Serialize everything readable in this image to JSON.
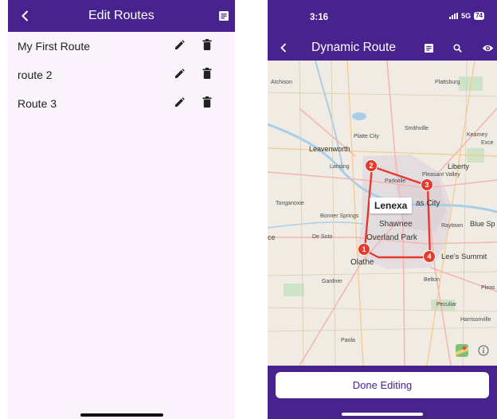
{
  "edit_screen": {
    "title": "Edit Routes",
    "routes": [
      {
        "name": "My First Route"
      },
      {
        "name": "route 2"
      },
      {
        "name": "Route 3"
      }
    ]
  },
  "route_screen": {
    "status_time": "3:16",
    "network": "5G",
    "battery": "74",
    "title": "Dynamic Route",
    "map": {
      "selected_place": "Lenexa",
      "places": [
        "Atchison",
        "Plattsburg",
        "Platte City",
        "Smithville",
        "Kearney",
        "Exce",
        "Leavenworth",
        "Lansing",
        "Liberty",
        "Pleasant Valley",
        "Parkville",
        "Tonganoxie",
        "as City",
        "Bonner Springs",
        "Shawnee",
        "Raytown",
        "Blue Sp",
        "De Soto",
        "Overland Park",
        "Lee's Summit",
        "ce",
        "Olathe",
        "Gardner",
        "Belton",
        "Pleas",
        "Peculiar",
        "Harrisonville",
        "Paola"
      ],
      "route_stops": [
        "1",
        "2",
        "3",
        "4"
      ]
    },
    "done_label": "Done Editing"
  },
  "colors": {
    "app_bar": "#48238e",
    "list_background": "#fbf3fb",
    "route_marker": "#e53a2e",
    "route_line": "#e53a2e"
  },
  "icons": [
    "back-chevron-icon",
    "list-icon",
    "edit-pencil-icon",
    "trash-icon",
    "search-icon",
    "eye-icon",
    "maps-icon",
    "info-icon"
  ]
}
